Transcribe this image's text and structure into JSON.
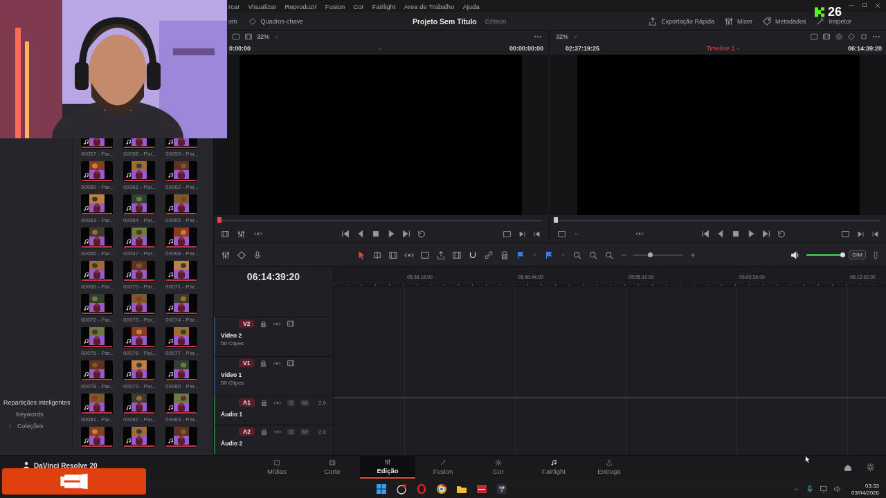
{
  "menu": [
    "rcar",
    "Visualizar",
    "Reproduzir",
    "Fusion",
    "Cor",
    "Fairlight",
    "Área de Trabalho",
    "Ajuda"
  ],
  "toolbar": {
    "left": [
      "om",
      "Quadros-chave"
    ],
    "project_title": "Projeto Sem Título",
    "status": "Editado",
    "right": [
      "Exportação Rápida",
      "Mixer",
      "Metadados",
      "Inspetor"
    ]
  },
  "follower_badge": {
    "count": "26"
  },
  "source_viewer": {
    "zoom": "32%",
    "timecode_left": "0:00:00",
    "timecode_right": "00:00:00:00",
    "level": 0
  },
  "timeline_viewer": {
    "zoom": "32%",
    "timecode_left": "02:37:19:25",
    "timeline_name": "Timeline 1",
    "timecode_right": "06:14:39:20",
    "level": 0
  },
  "smart_bins": {
    "title": "Repartições Inteligentes",
    "items": [
      {
        "label": "Keywords"
      },
      {
        "label": "Coleções",
        "expanded": false
      }
    ]
  },
  "clips": [
    {
      "kind": "clip",
      "label": "00057 - Par..."
    },
    {
      "kind": "clip",
      "label": "00058 - Par..."
    },
    {
      "kind": "clip",
      "label": "00059 - Par..."
    },
    {
      "kind": "clip",
      "label": "00060 - Par..."
    },
    {
      "kind": "clip",
      "label": "00061 - Par..."
    },
    {
      "kind": "clip",
      "label": "00062 - Par..."
    },
    {
      "kind": "clip",
      "label": "00063 - Par..."
    },
    {
      "kind": "clip",
      "label": "00064 - Par..."
    },
    {
      "kind": "clip",
      "label": "00065 - Par..."
    },
    {
      "kind": "clip",
      "label": "00066 - Par..."
    },
    {
      "kind": "clip",
      "label": "00067 - Par..."
    },
    {
      "kind": "clip",
      "label": "00068 - Par..."
    },
    {
      "kind": "clip",
      "label": "00069 - Par..."
    },
    {
      "kind": "clip",
      "label": "00070 - Par..."
    },
    {
      "kind": "clip",
      "label": "00071 - Par..."
    },
    {
      "kind": "clip",
      "label": "00072 - Par..."
    },
    {
      "kind": "clip",
      "label": "00073 - Par..."
    },
    {
      "kind": "clip",
      "label": "00074 - Par..."
    },
    {
      "kind": "clip",
      "label": "00075 - Par..."
    },
    {
      "kind": "clip",
      "label": "00076 - Par..."
    },
    {
      "kind": "clip",
      "label": "00077 - Par..."
    },
    {
      "kind": "clip",
      "label": "00078 - Par..."
    },
    {
      "kind": "clip",
      "label": "00079 - Par..."
    },
    {
      "kind": "clip",
      "label": "00080 - Par..."
    },
    {
      "kind": "clip",
      "label": "00081 - Par..."
    },
    {
      "kind": "clip",
      "label": "00082 - Par..."
    },
    {
      "kind": "clip",
      "label": "00083 - Par..."
    },
    {
      "kind": "thumb"
    },
    {
      "kind": "thumb"
    },
    {
      "kind": "thumb"
    }
  ],
  "app_badge": {
    "label": "DaVinci Resolve 20"
  },
  "timeline_toolbar": {
    "zoom_slider": {
      "level": 0.33
    },
    "volume": {
      "level": 1
    },
    "dim": "DIM"
  },
  "timeline": {
    "timecode": "06:14:39:20",
    "ruler": [
      "05:38:18:00",
      "05:46:44:00",
      "05:55:10:00",
      "06:03:36:00",
      "06:12:02:00"
    ],
    "tracks": [
      {
        "kind": "video",
        "tag": "V2",
        "name": "Vídeo 2",
        "detail": "50 Clipes"
      },
      {
        "kind": "video",
        "tag": "V1",
        "name": "Vídeo 1",
        "detail": "50 Clipes"
      },
      {
        "kind": "audio",
        "tag": "A1",
        "name": "Áudio 1",
        "solo": "S",
        "mute": "M",
        "channels": "2.0"
      },
      {
        "kind": "audio",
        "tag": "A2",
        "name": "Áudio 2",
        "solo": "S",
        "mute": "M",
        "channels": "2.0"
      }
    ]
  },
  "pages": [
    {
      "label": "Mídias",
      "selected": false
    },
    {
      "label": "Corte",
      "selected": false
    },
    {
      "label": "Edição",
      "selected": true
    },
    {
      "label": "Fusion",
      "selected": false
    },
    {
      "label": "Cor",
      "selected": false
    },
    {
      "label": "Fairlight",
      "selected": false
    },
    {
      "label": "Entrega",
      "selected": false
    }
  ],
  "taskbar": {
    "time": "03:33",
    "date": "03/04/2026"
  }
}
